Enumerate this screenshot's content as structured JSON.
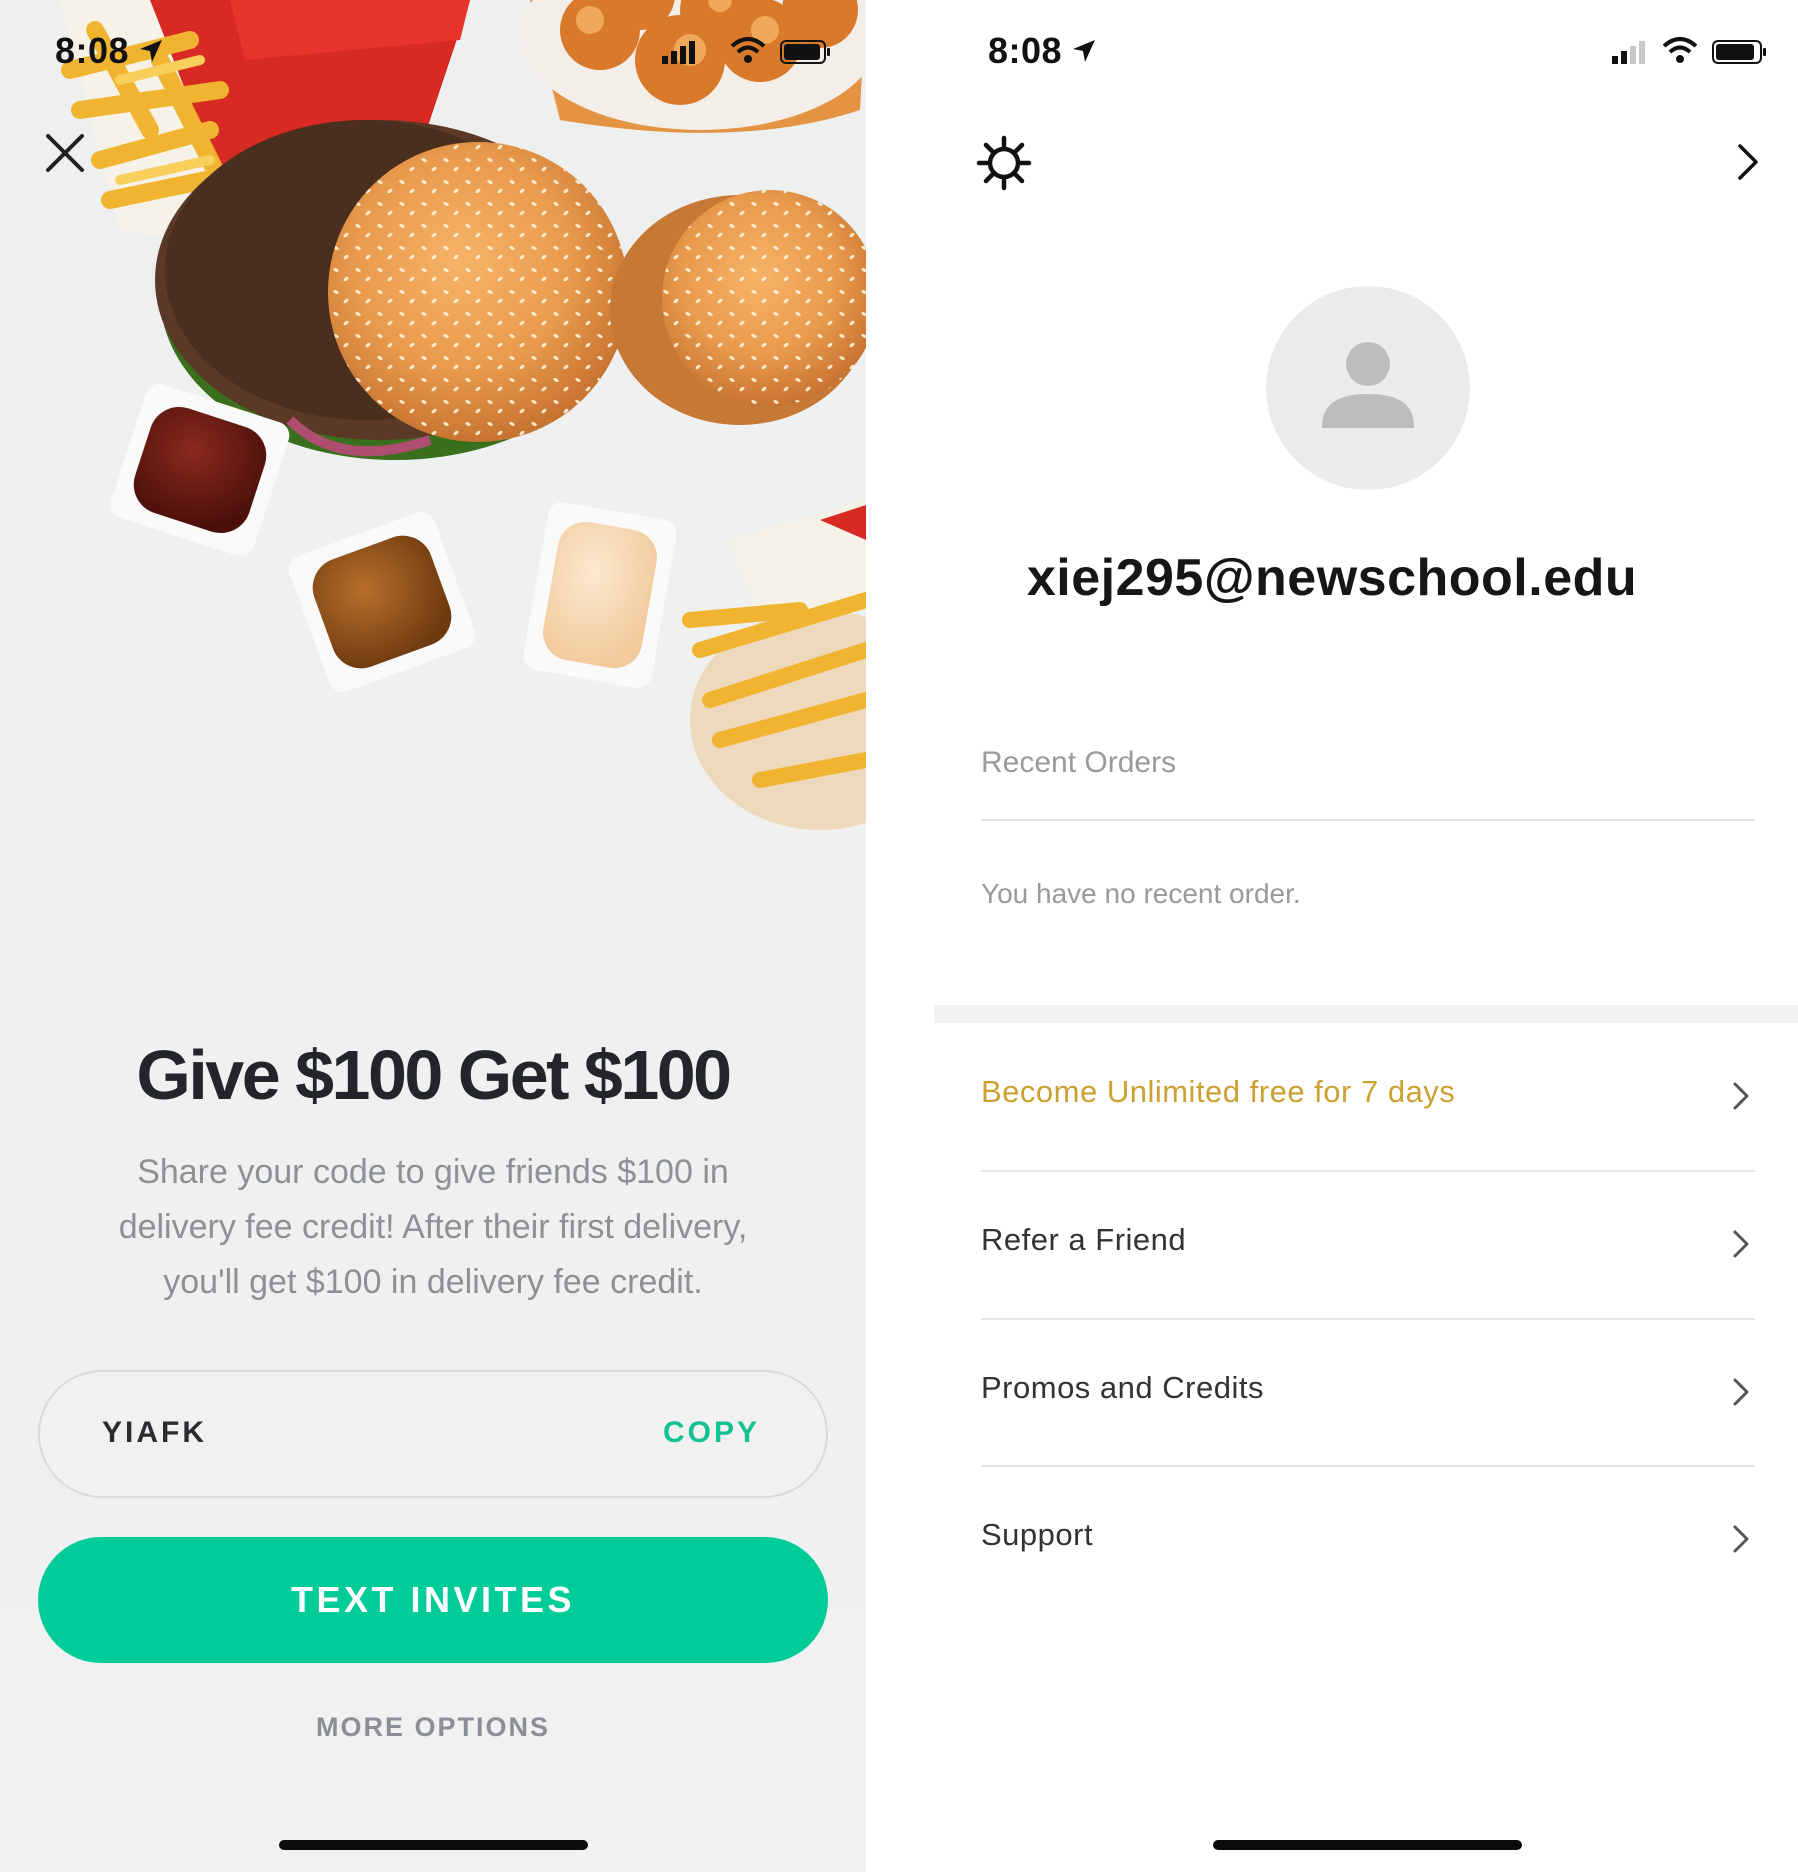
{
  "left_screen": {
    "status_bar": {
      "time": "8:08"
    },
    "promo": {
      "title": "Give $100 Get $100",
      "description_lines": [
        "Share your code to give friends $100 in",
        "delivery fee credit! After their first delivery,",
        "you'll get $100 in delivery fee credit."
      ]
    },
    "code_field": {
      "code": "YIAFK",
      "copy_label": "COPY"
    },
    "primary_button": {
      "label": "TEXT INVITES"
    },
    "secondary_link": {
      "label": "MORE OPTIONS"
    },
    "colors": {
      "accent": "#00cc99",
      "copy": "#14c191"
    },
    "icons": {
      "close": "close-icon"
    }
  },
  "right_screen": {
    "status_bar": {
      "time": "8:08"
    },
    "header": {
      "settings_icon": "gear-icon",
      "nav_icon": "chevron-right-icon"
    },
    "profile": {
      "email": "xiej295@newschool.edu",
      "avatar_icon": "person-icon"
    },
    "recent_orders": {
      "title": "Recent Orders",
      "empty_message": "You have no recent order."
    },
    "menu": [
      {
        "label": "Become Unlimited free for 7 days",
        "highlight": true
      },
      {
        "label": "Refer a Friend",
        "highlight": false
      },
      {
        "label": "Promos and Credits",
        "highlight": false
      },
      {
        "label": "Support",
        "highlight": false
      }
    ],
    "colors": {
      "highlight": "#cba132"
    }
  }
}
